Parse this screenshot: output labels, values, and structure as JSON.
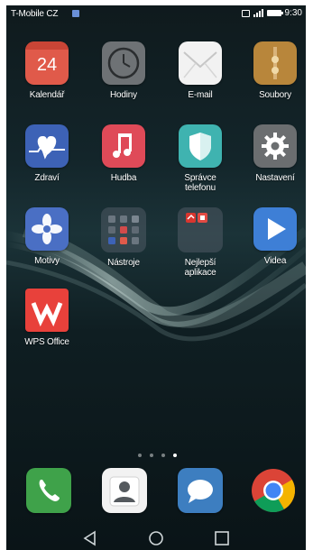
{
  "status_bar": {
    "carrier": "T-Mobile CZ",
    "time": "9:30",
    "icons": [
      "nfc-icon",
      "signal-icon",
      "battery-icon"
    ]
  },
  "apps": [
    {
      "label": "Kalendář",
      "icon": "calendar-icon",
      "badge": "24",
      "color": "#e05a4a"
    },
    {
      "label": "Hodiny",
      "icon": "clock-icon",
      "color": "#6e7275"
    },
    {
      "label": "E-mail",
      "icon": "envelope-icon",
      "color": "#f2f2f2"
    },
    {
      "label": "Soubory",
      "icon": "folder-file-icon",
      "color": "#b8863b"
    },
    {
      "label": "Zdraví",
      "icon": "health-heart-icon",
      "color": "#3d62b6"
    },
    {
      "label": "Hudba",
      "icon": "music-note-icon",
      "color": "#df4a58"
    },
    {
      "label": "Správce telefonu",
      "icon": "shield-icon",
      "color": "#3fb3b0"
    },
    {
      "label": "Nastavení",
      "icon": "gear-icon",
      "color": "#6b6e70"
    },
    {
      "label": "Motivy",
      "icon": "themes-flower-icon",
      "color": "#4a6fc4"
    },
    {
      "label": "Nástroje",
      "icon": "tools-folder-icon",
      "color": "#3a4450"
    },
    {
      "label": "Nejlepší aplikace",
      "icon": "top-apps-folder-icon",
      "color": "#3a4450"
    },
    {
      "label": "Videa",
      "icon": "play-icon",
      "color": "#3e7fd6"
    },
    {
      "label": "WPS Office",
      "icon": "wps-office-icon",
      "color": "#e8413b"
    }
  ],
  "page_indicator": {
    "count": 4,
    "active_index": 3
  },
  "dock": [
    {
      "name": "phone-icon",
      "color": "#3fa24a"
    },
    {
      "name": "contacts-icon",
      "color": "#f2f2f2"
    },
    {
      "name": "messages-icon",
      "color": "#3d7ec0"
    },
    {
      "name": "chrome-icon",
      "color": "#ffffff"
    }
  ],
  "nav": [
    "back-icon",
    "home-icon",
    "recents-icon"
  ]
}
